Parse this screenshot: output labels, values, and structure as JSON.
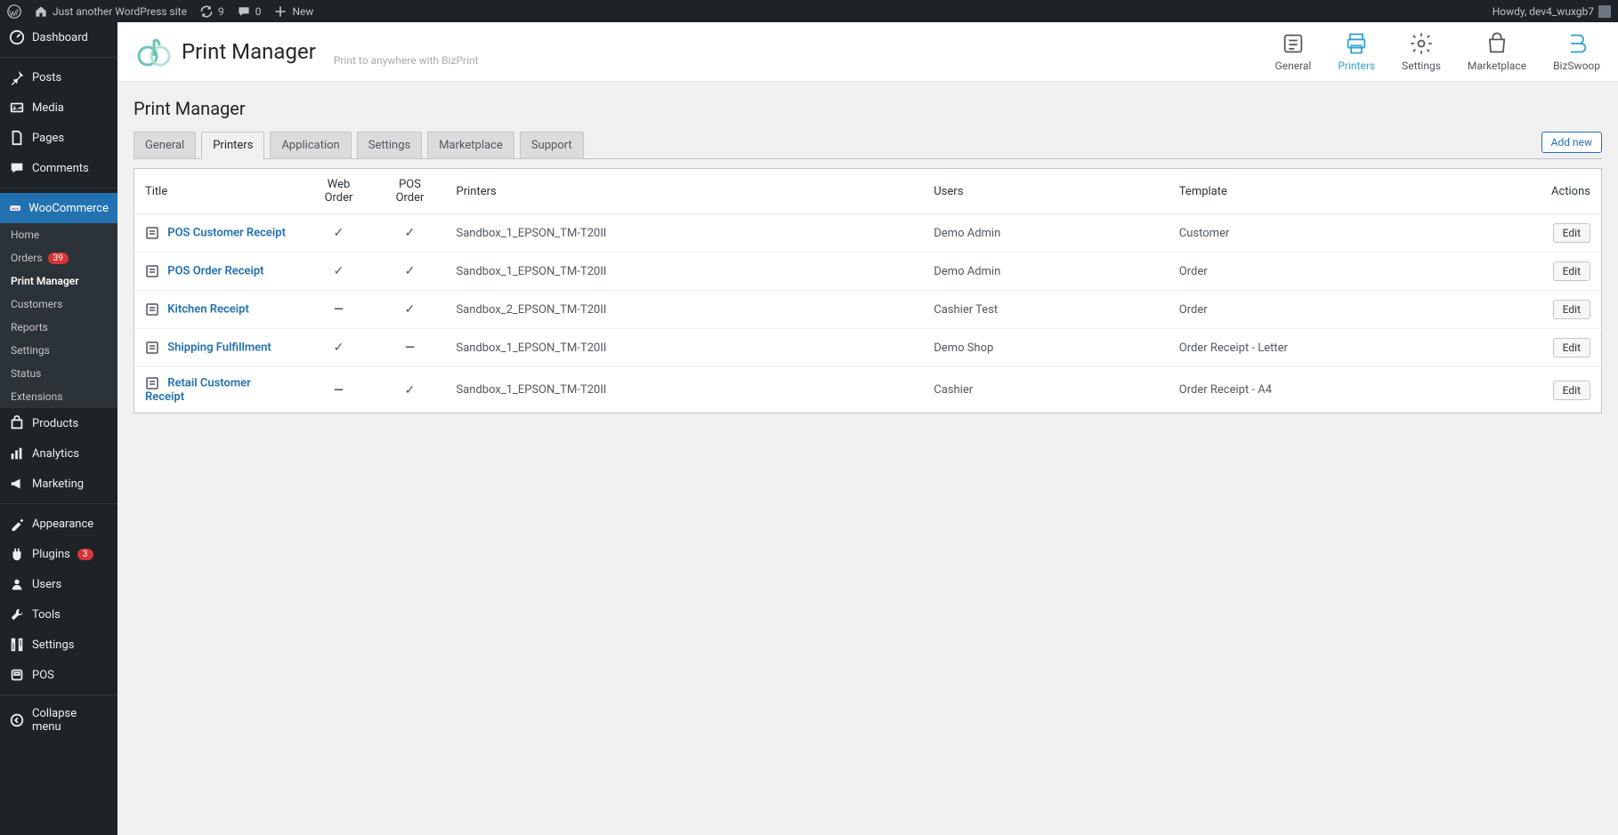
{
  "adminbar": {
    "site_name": "Just another WordPress site",
    "updates": "9",
    "comments": "0",
    "new": "New",
    "howdy": "Howdy, dev4_wuxgb7"
  },
  "sidebar": {
    "dashboard": "Dashboard",
    "posts": "Posts",
    "media": "Media",
    "pages": "Pages",
    "comments": "Comments",
    "woocommerce": "WooCommerce",
    "woo_sub": {
      "home": "Home",
      "orders": "Orders",
      "orders_badge": "39",
      "print_manager": "Print Manager",
      "customers": "Customers",
      "reports": "Reports",
      "settings": "Settings",
      "status": "Status",
      "extensions": "Extensions"
    },
    "products": "Products",
    "analytics": "Analytics",
    "marketing": "Marketing",
    "appearance": "Appearance",
    "plugins": "Plugins",
    "plugins_badge": "3",
    "users": "Users",
    "tools": "Tools",
    "settings": "Settings",
    "pos": "POS",
    "collapse": "Collapse menu"
  },
  "header": {
    "brand_title": "Print Manager",
    "brand_sub": "Print to anywhere with BizPrint",
    "nav": {
      "general": "General",
      "printers": "Printers",
      "settings": "Settings",
      "marketplace": "Marketplace",
      "bizswoop": "BizSwoop"
    }
  },
  "page": {
    "title": "Print Manager",
    "tabs": {
      "general": "General",
      "printers": "Printers",
      "application": "Application",
      "settings": "Settings",
      "marketplace": "Marketplace",
      "support": "Support"
    },
    "add_new": "Add new"
  },
  "table": {
    "headers": {
      "title": "Title",
      "web_order": "Web Order",
      "pos_order": "POS Order",
      "printers": "Printers",
      "users": "Users",
      "template": "Template",
      "actions": "Actions"
    },
    "rows": [
      {
        "title": "POS Customer Receipt",
        "web": "✓",
        "pos": "✓",
        "printers": "Sandbox_1_EPSON_TM-T20II",
        "users": "Demo Admin",
        "template": "Customer",
        "action": "Edit"
      },
      {
        "title": "POS Order Receipt",
        "web": "✓",
        "pos": "✓",
        "printers": "Sandbox_1_EPSON_TM-T20II",
        "users": "Demo Admin",
        "template": "Order",
        "action": "Edit"
      },
      {
        "title": "Kitchen Receipt",
        "web": "—",
        "pos": "✓",
        "printers": "Sandbox_2_EPSON_TM-T20II",
        "users": "Cashier Test",
        "template": "Order",
        "action": "Edit"
      },
      {
        "title": "Shipping Fulfillment",
        "web": "✓",
        "pos": "—",
        "printers": "Sandbox_1_EPSON_TM-T20II",
        "users": "Demo Shop",
        "template": "Order Receipt - Letter",
        "action": "Edit"
      },
      {
        "title": "Retail Customer Receipt",
        "web": "—",
        "pos": "✓",
        "printers": "Sandbox_1_EPSON_TM-T20II",
        "users": "Cashier",
        "template": "Order Receipt - A4",
        "action": "Edit"
      }
    ]
  }
}
